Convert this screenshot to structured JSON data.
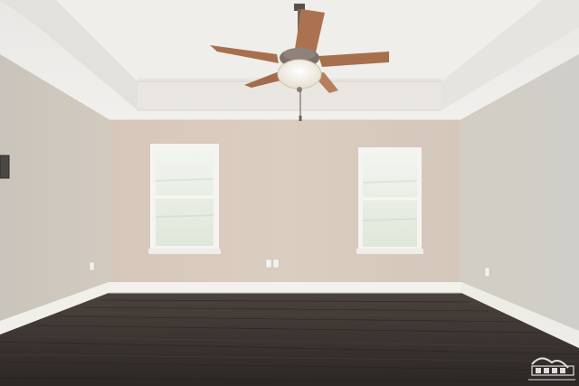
{
  "scene": {
    "description_colors": {
      "ceiling": "#ecebe8",
      "tray_ceiling": "#f1f0ec",
      "back_wall": "#d8cabd",
      "left_wall": "#cdc7bd",
      "right_wall": "#cfcdc6",
      "floor_dark": "#2f2a27",
      "floor_mid": "#4a423d",
      "baseboard": "#f3f2ee",
      "window_glass": "#e9efe7",
      "fan_blade": "#b07552",
      "fan_body": "#7a6d63",
      "fan_light": "#f2efe6"
    },
    "icons": [
      "ceiling-fan-icon",
      "window-icon",
      "outlet-icon",
      "watermark-logo-icon"
    ]
  }
}
